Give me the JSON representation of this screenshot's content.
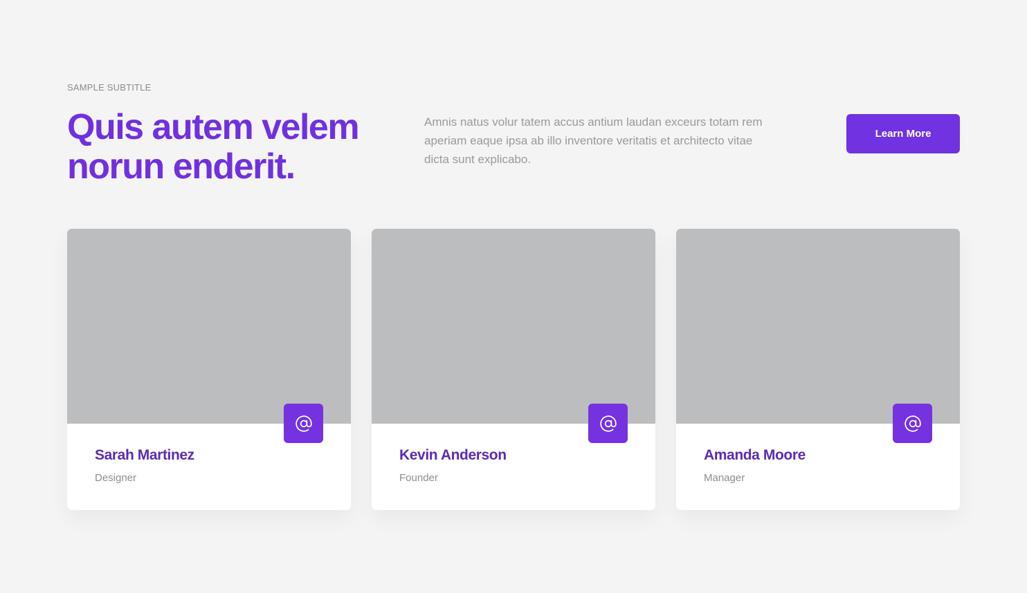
{
  "header": {
    "subtitle": "SAMPLE SUBTITLE",
    "title": "Quis autem velem norun enderit.",
    "description": "Amnis natus volur tatem accus antium laudan exceurs totam rem aperiam eaque ipsa ab illo inventore veritatis et architecto vitae dicta sunt explicabo.",
    "cta_label": "Learn More"
  },
  "team": [
    {
      "name": "Sarah Martinez",
      "role": "Designer",
      "icon": "at-sign-icon"
    },
    {
      "name": "Kevin Anderson",
      "role": "Founder",
      "icon": "at-sign-icon"
    },
    {
      "name": "Amanda Moore",
      "role": "Manager",
      "icon": "at-sign-icon"
    }
  ],
  "colors": {
    "accent": "#7132e1",
    "name_text": "#5a2bb4",
    "background": "#f4f4f4",
    "image_placeholder": "#bcbdbf"
  }
}
